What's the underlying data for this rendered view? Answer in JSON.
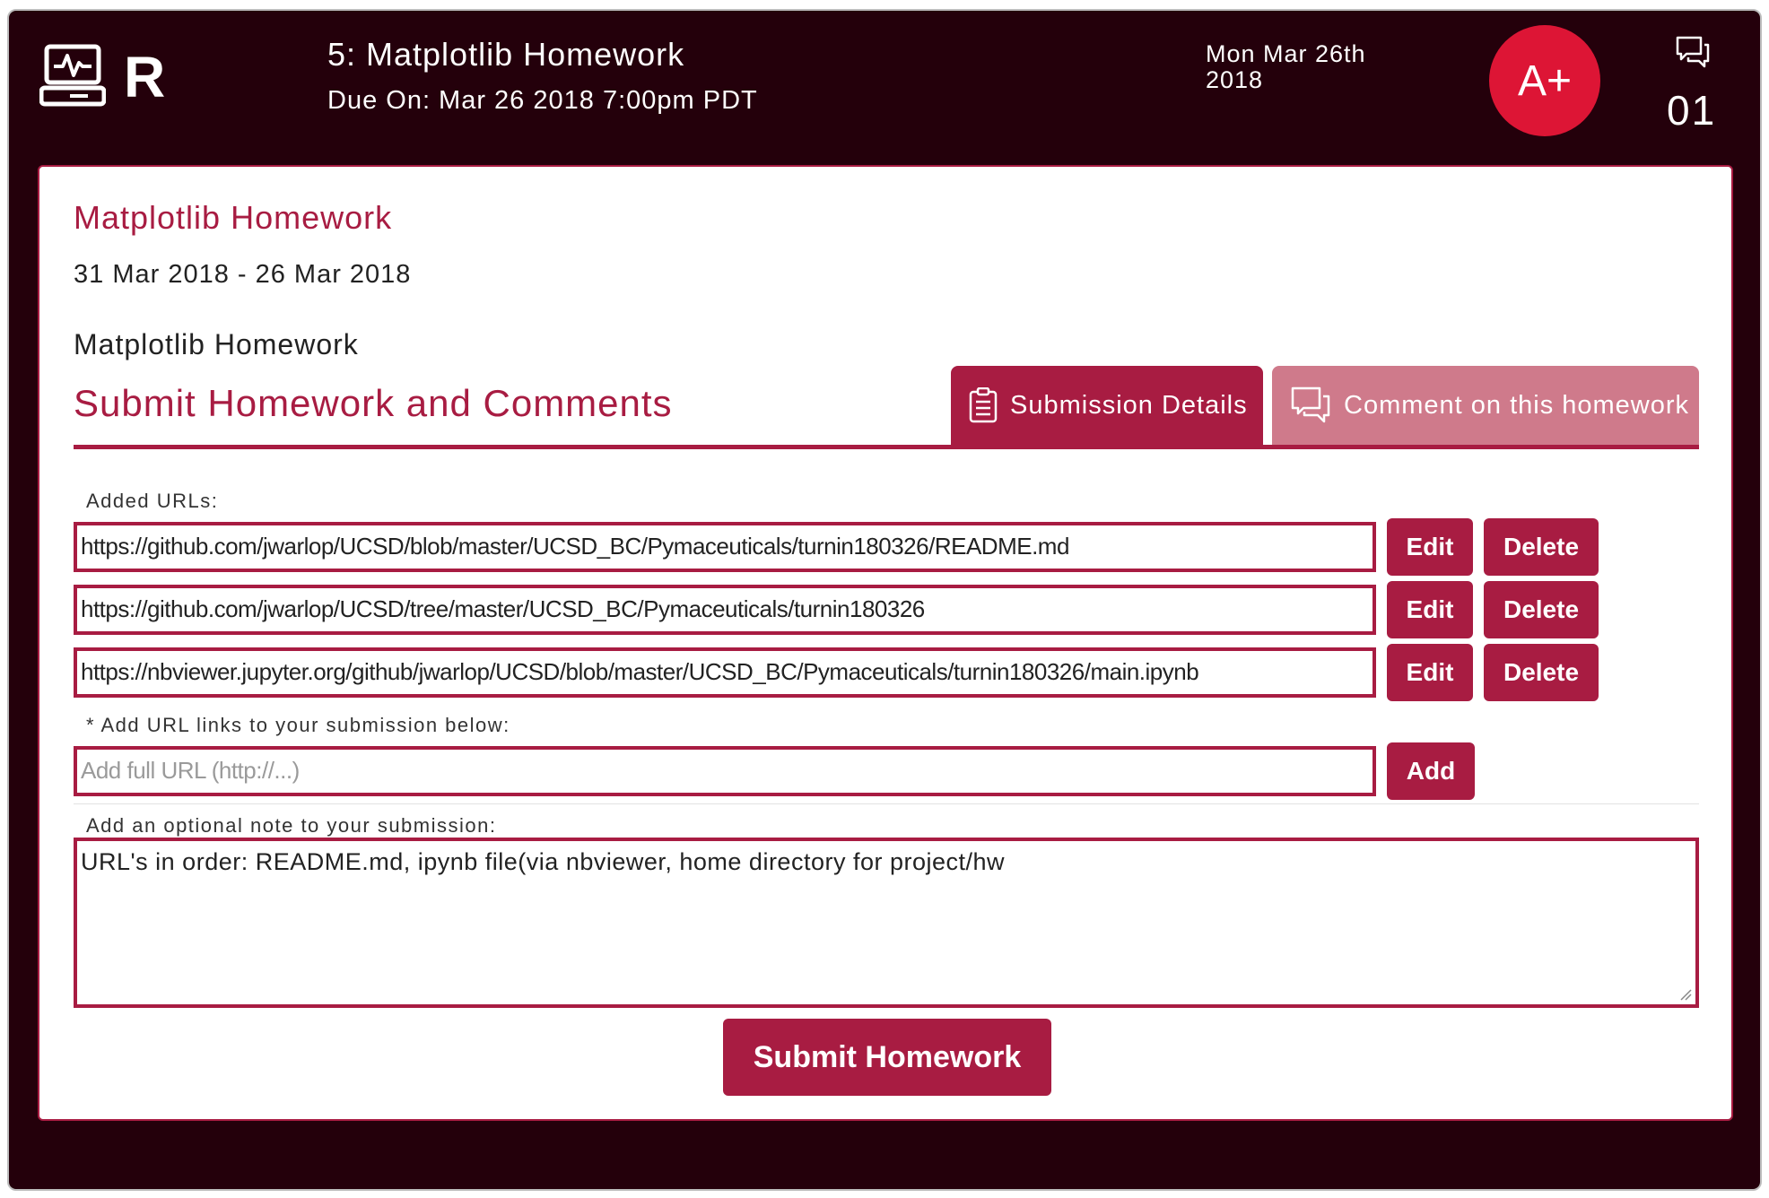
{
  "header": {
    "logo_icon": "computer-activity-icon",
    "letter": "R",
    "assignment_title": "5: Matplotlib Homework",
    "due_on": "Due On: Mar 26 2018 7:00pm PDT",
    "current_date": "Mon Mar 26th 2018",
    "grade": "A+",
    "messages_icon": "chat-bubbles-icon",
    "message_count": "01"
  },
  "card": {
    "title": "Matplotlib Homework",
    "date_range": "31 Mar 2018 - 26 Mar 2018",
    "subtitle": "Matplotlib Homework",
    "section_heading": "Submit Homework and Comments",
    "tabs": [
      {
        "label": "Submission Details",
        "icon": "clipboard-list-icon",
        "active": true
      },
      {
        "label": "Comment on this homework",
        "icon": "chat-bubbles-icon",
        "active": false
      }
    ],
    "added_urls_label": "Added URLs:",
    "urls": [
      {
        "value": "https://github.com/jwarlop/UCSD/blob/master/UCSD_BC/Pymaceuticals/turnin180326/README.md",
        "edit": "Edit",
        "delete": "Delete"
      },
      {
        "value": "https://github.com/jwarlop/UCSD/tree/master/UCSD_BC/Pymaceuticals/turnin180326",
        "edit": "Edit",
        "delete": "Delete"
      },
      {
        "value": "https://nbviewer.jupyter.org/github/jwarlop/UCSD/blob/master/UCSD_BC/Pymaceuticals/turnin180326/main.ipynb",
        "edit": "Edit",
        "delete": "Delete"
      }
    ],
    "add_url_label": "* Add URL links to your submission below:",
    "add_url_placeholder": "Add full URL (http://...)",
    "add_button": "Add",
    "note_label": "Add an optional note to your submission:",
    "note_value": "URL's in order: README.md, ipynb file(via nbviewer, home directory for project/hw",
    "submit_button": "Submit Homework"
  },
  "colors": {
    "background": "#24000b",
    "accent": "#a81c42",
    "accent_light": "#cf7a8b",
    "grade_badge": "#dd1535"
  }
}
